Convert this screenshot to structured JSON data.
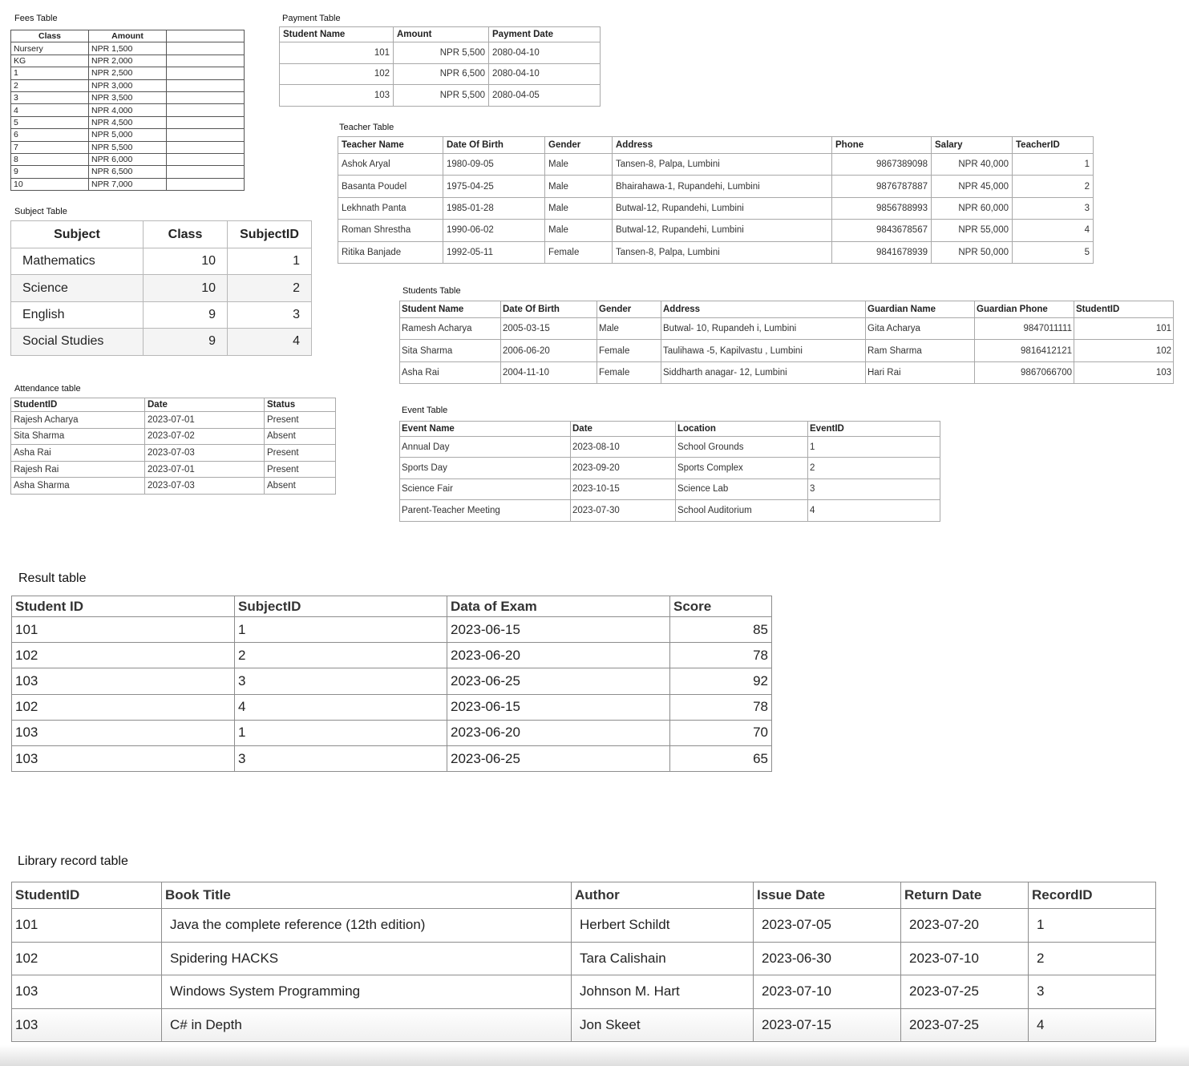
{
  "fees": {
    "title": "Fees Table",
    "headers": [
      "Class",
      "Amount",
      ""
    ],
    "rows": [
      [
        "Nursery",
        "NPR 1,500"
      ],
      [
        "KG",
        "NPR 2,000"
      ],
      [
        "1",
        "NPR 2,500"
      ],
      [
        "2",
        "NPR 3,000"
      ],
      [
        "3",
        "NPR 3,500"
      ],
      [
        "4",
        "NPR 4,000"
      ],
      [
        "5",
        "NPR 4,500"
      ],
      [
        "6",
        "NPR 5,000"
      ],
      [
        "7",
        "NPR 5,500"
      ],
      [
        "8",
        "NPR 6,000"
      ],
      [
        "9",
        "NPR 6,500"
      ],
      [
        "10",
        "NPR 7,000"
      ]
    ]
  },
  "payment": {
    "title": "Payment Table",
    "headers": [
      "Student Name",
      "Amount",
      "Payment Date"
    ],
    "rows": [
      [
        "101",
        "NPR 5,500",
        "2080-04-10"
      ],
      [
        "102",
        "NPR 6,500",
        "2080-04-10"
      ],
      [
        "103",
        "NPR 5,500",
        "2080-04-05"
      ]
    ]
  },
  "teacher": {
    "title": "Teacher Table",
    "headers": [
      "Teacher Name",
      "Date Of Birth",
      "Gender",
      "Address",
      "Phone",
      "Salary",
      "TeacherID"
    ],
    "rows": [
      [
        "Ashok Aryal",
        "1980-09-05",
        "Male",
        "Tansen-8, Palpa, Lumbini",
        "9867389098",
        "NPR 40,000",
        "1"
      ],
      [
        "Basanta Poudel",
        "1975-04-25",
        "Male",
        "Bhairahawa-1, Rupandehi, Lumbini",
        "9876787887",
        "NPR 45,000",
        "2"
      ],
      [
        "Lekhnath Panta",
        "1985-01-28",
        "Male",
        "Butwal-12, Rupandehi, Lumbini",
        "9856788993",
        "NPR 60,000",
        "3"
      ],
      [
        "Roman Shrestha",
        "1990-06-02",
        "Male",
        "Butwal-12, Rupandehi, Lumbini",
        "9843678567",
        "NPR 55,000",
        "4"
      ],
      [
        "Ritika Banjade",
        "1992-05-11",
        "Female",
        "Tansen-8, Palpa, Lumbini",
        "9841678939",
        "NPR 50,000",
        "5"
      ]
    ]
  },
  "subject": {
    "title": "Subject Table",
    "headers": [
      "Subject",
      "Class",
      "SubjectID"
    ],
    "rows": [
      [
        "Mathematics",
        "10",
        "1"
      ],
      [
        "Science",
        "10",
        "2"
      ],
      [
        "English",
        "9",
        "3"
      ],
      [
        "Social Studies",
        "9",
        "4"
      ]
    ]
  },
  "students": {
    "title": "Students Table",
    "headers": [
      "Student Name",
      "Date Of Birth",
      "Gender",
      "Address",
      "Guardian Name",
      "Guardian Phone",
      "StudentID"
    ],
    "rows": [
      [
        "Ramesh Acharya",
        "2005-03-15",
        "Male",
        "Butwal- 10, Rupandeh i, Lumbini",
        "Gita Acharya",
        "9847011111",
        "101"
      ],
      [
        "Sita Sharma",
        "2006-06-20",
        "Female",
        "Taulihawa -5, Kapilvastu , Lumbini",
        "Ram Sharma",
        "9816412121",
        "102"
      ],
      [
        "Asha Rai",
        "2004-11-10",
        "Female",
        "Siddharth anagar- 12, Lumbini",
        "Hari Rai",
        "9867066700",
        "103"
      ]
    ]
  },
  "attendance": {
    "title": "Attendance table",
    "headers": [
      "StudentID",
      "Date",
      "Status"
    ],
    "rows": [
      [
        "Rajesh Acharya",
        "2023-07-01",
        "Present"
      ],
      [
        "Sita Sharma",
        "2023-07-02",
        "Absent"
      ],
      [
        "Asha Rai",
        "2023-07-03",
        "Present"
      ],
      [
        "Rajesh Rai",
        "2023-07-01",
        "Present"
      ],
      [
        "Asha Sharma",
        "2023-07-03",
        "Absent"
      ]
    ]
  },
  "event": {
    "title": "Event Table",
    "headers": [
      "Event Name",
      "Date",
      "Location",
      "EventID"
    ],
    "rows": [
      [
        "Annual Day",
        "2023-08-10",
        "School Grounds",
        "1"
      ],
      [
        "Sports Day",
        "2023-09-20",
        "Sports Complex",
        "2"
      ],
      [
        "Science Fair",
        "2023-10-15",
        "Science Lab",
        "3"
      ],
      [
        "Parent-Teacher Meeting",
        "2023-07-30",
        "School Auditorium",
        "4"
      ]
    ]
  },
  "result": {
    "title": "Result table",
    "headers": [
      "Student ID",
      "SubjectID",
      "Data of Exam",
      "Score"
    ],
    "rows": [
      [
        "101",
        "1",
        "2023-06-15",
        "85"
      ],
      [
        "102",
        "2",
        "2023-06-20",
        "78"
      ],
      [
        "103",
        "3",
        "2023-06-25",
        "92"
      ],
      [
        "102",
        "4",
        "2023-06-15",
        "78"
      ],
      [
        "103",
        "1",
        "2023-06-20",
        "70"
      ],
      [
        "103",
        "3",
        "2023-06-25",
        "65"
      ]
    ]
  },
  "library": {
    "title": "Library record table",
    "headers": [
      "StudentID",
      "Book Title",
      "Author",
      "Issue Date",
      "Return Date",
      "RecordID"
    ],
    "rows": [
      [
        "101",
        "Java the complete reference (12th edition)",
        "Herbert Schildt",
        "2023-07-05",
        "2023-07-20",
        "1"
      ],
      [
        "102",
        "Spidering HACKS",
        "Tara Calishain",
        "2023-06-30",
        "2023-07-10",
        "2"
      ],
      [
        "103",
        "Windows System Programming",
        "Johnson M. Hart",
        "2023-07-10",
        "2023-07-25",
        "3"
      ],
      [
        "103",
        "C# in Depth",
        "Jon Skeet",
        "2023-07-15",
        "2023-07-25",
        "4"
      ]
    ]
  }
}
